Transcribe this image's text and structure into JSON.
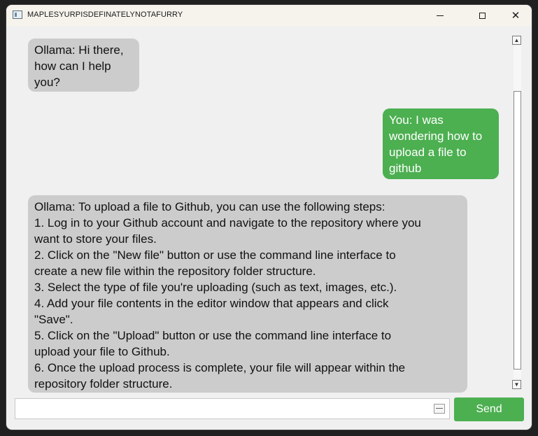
{
  "window": {
    "title": "MAPLESYURPISDEFINATELYNOTAFURRY"
  },
  "messages": [
    {
      "role": "bot",
      "lines": [
        "Ollama: Hi there,",
        "how can I help",
        "you?"
      ]
    },
    {
      "role": "user",
      "lines": [
        "You: I was",
        "wondering how to",
        "upload a file to",
        "github"
      ]
    },
    {
      "role": "bot",
      "lines": [
        "Ollama: To upload a file to Github, you can use the following steps:",
        "1. Log in to your Github account and navigate to the repository where you",
        "want to store your files.",
        "2. Click on the \"New file\" button or use the command line interface to",
        "create a new file within the repository folder structure.",
        "3. Select the type of file you're uploading (such as text, images, etc.).",
        "4. Add your file contents in the editor window that appears and click",
        "\"Save\".",
        "5. Click on the \"Upload\" button or use the command line interface to",
        "upload your file to Github.",
        "6. Once the upload process is complete, your file will appear within the",
        "repository folder structure."
      ]
    }
  ],
  "input": {
    "value": "",
    "placeholder": ""
  },
  "send": {
    "label": "Send"
  },
  "icons": {
    "app": "app-window-icon",
    "minimize": "minimize-icon",
    "maximize": "maximize-icon",
    "close": "close-icon",
    "scroll_up": "scroll-up-arrow-icon",
    "scroll_down": "scroll-down-arrow-icon"
  },
  "colors": {
    "user_bubble": "#4caf50",
    "bot_bubble": "#cccccc",
    "send_button": "#4caf50",
    "background": "#f0f0f0"
  }
}
